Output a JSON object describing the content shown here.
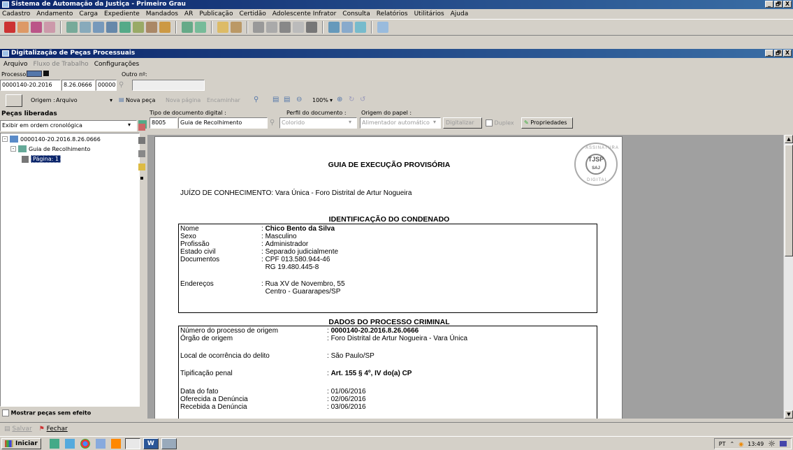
{
  "app": {
    "title": "Sistema de Automação da Justiça - Primeiro Grau",
    "menu": [
      "Cadastro",
      "Andamento",
      "Carga",
      "Expediente",
      "Mandados",
      "AR",
      "Publicação",
      "Certidão",
      "Adolescente Infrator",
      "Consulta",
      "Relatórios",
      "Utilitários",
      "Ajuda"
    ],
    "window_buttons": [
      "_",
      "🗗",
      "X"
    ]
  },
  "child": {
    "title": "Digitalização de Peças Processuais",
    "menu": {
      "arquivo": "Arquivo",
      "fluxo": "Fluxo de Trabalho",
      "config": "Configurações"
    }
  },
  "processo": {
    "label": "Processo:",
    "outro_label": "Outro nº:",
    "part1": "0000140-20.2016",
    "part2": "8.26.0666",
    "part3": "00000",
    "outro_value": ""
  },
  "toolbar2": {
    "origem": "Origem :",
    "origem_value": "Arquivo",
    "nova_peca": "Nova peça",
    "nova_pagina": "Nova página",
    "encaminhar": "Encaminhar",
    "zoom": "100%"
  },
  "pecas": {
    "header": "Peças liberadas",
    "order": "Exibir em ordem cronológica",
    "tree": [
      {
        "label": "0000140-20.2016.8.26.0666"
      },
      {
        "label": "Guia de Recolhimento"
      },
      {
        "label": "Página: 1"
      }
    ],
    "mostrar": "Mostrar peças sem efeito"
  },
  "docbar": {
    "tipo_label": "Tipo de documento digital :",
    "tipo_code": "8005",
    "tipo_value": "Guia de Recolhimento",
    "perfil_label": "Perfil do documento :",
    "perfil_value": "Colorido",
    "origem_label": "Origem do papel :",
    "origem_value": "Alimentador automático",
    "digitalizar": "Digitalizar",
    "duplex": "Duplex",
    "propriedades": "Propriedades"
  },
  "document": {
    "title": "GUIA DE EXECUÇÃO PROVISÓRIA",
    "juizo": "JUÍZO DE CONHECIMENTO: Vara Única - Foro Distrital de Artur Nogueira",
    "sec1_title": "IDENTIFICAÇÃO DO CONDENADO",
    "sec1": [
      {
        "k": "Nome",
        "v": "Chico Bento da Silva",
        "bold": true
      },
      {
        "k": "Sexo",
        "v": "Masculino"
      },
      {
        "k": "Profissão",
        "v": "Administrador"
      },
      {
        "k": "Estado civil",
        "v": "Separado judicialmente"
      },
      {
        "k": "Documentos",
        "v": "CPF 013.580.944-46"
      },
      {
        "k": "",
        "v": "RG 19.480.445-8",
        "nocolon": true
      },
      {
        "k": "Endereços",
        "v": "Rua XV de Novembro, 55"
      },
      {
        "k": "",
        "v": "Centro - Guararapes/SP",
        "nocolon": true
      }
    ],
    "sec2_title": "DADOS DO PROCESSO CRIMINAL",
    "sec2": [
      {
        "k": "Número do processo de origem",
        "v": "0000140-20.2016.8.26.0666",
        "bold": true
      },
      {
        "k": "Órgão de origem",
        "v": "Foro Distrital de Artur Nogueira - Vara Única"
      },
      {
        "k": "Local de ocorrência do delito",
        "v": "São Paulo/SP"
      },
      {
        "k": "Tipificação penal",
        "v": "Art. 155 § 4º, IV do(a) CP",
        "bold": true
      },
      {
        "k": "Data do fato",
        "v": "01/06/2016"
      },
      {
        "k": "Oferecida a Denúncia",
        "v": "02/06/2016"
      },
      {
        "k": "Recebida a Denúncia",
        "v": "03/06/2016"
      }
    ],
    "seal": {
      "top": "ASSINATURA",
      "mid": "TJSP",
      "sub": "SAJ",
      "bottom": "DIGITAL"
    }
  },
  "footer": {
    "salvar": "Salvar",
    "fechar": "Fechar"
  },
  "taskbar": {
    "start": "Iniciar",
    "lang": "PT",
    "time": "13:49"
  }
}
